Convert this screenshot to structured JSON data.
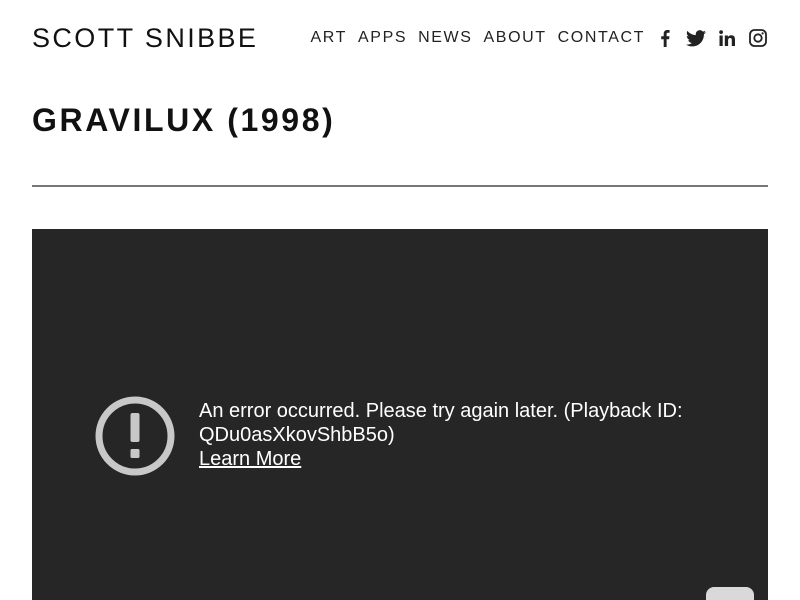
{
  "header": {
    "site_title": "SCOTT SNIBBE",
    "nav": [
      "ART",
      "APPS",
      "NEWS",
      "ABOUT",
      "CONTACT"
    ],
    "social_icons": [
      "facebook-icon",
      "twitter-icon",
      "linkedin-icon",
      "instagram-icon"
    ]
  },
  "page": {
    "title": "GRAVILUX (1998)"
  },
  "video": {
    "error_message": "An error occurred. Please try again later. (Playback ID: QDu0asXkovShbB5o)",
    "learn_more": "Learn More",
    "icon": "error-icon",
    "background_color": "#262626"
  }
}
